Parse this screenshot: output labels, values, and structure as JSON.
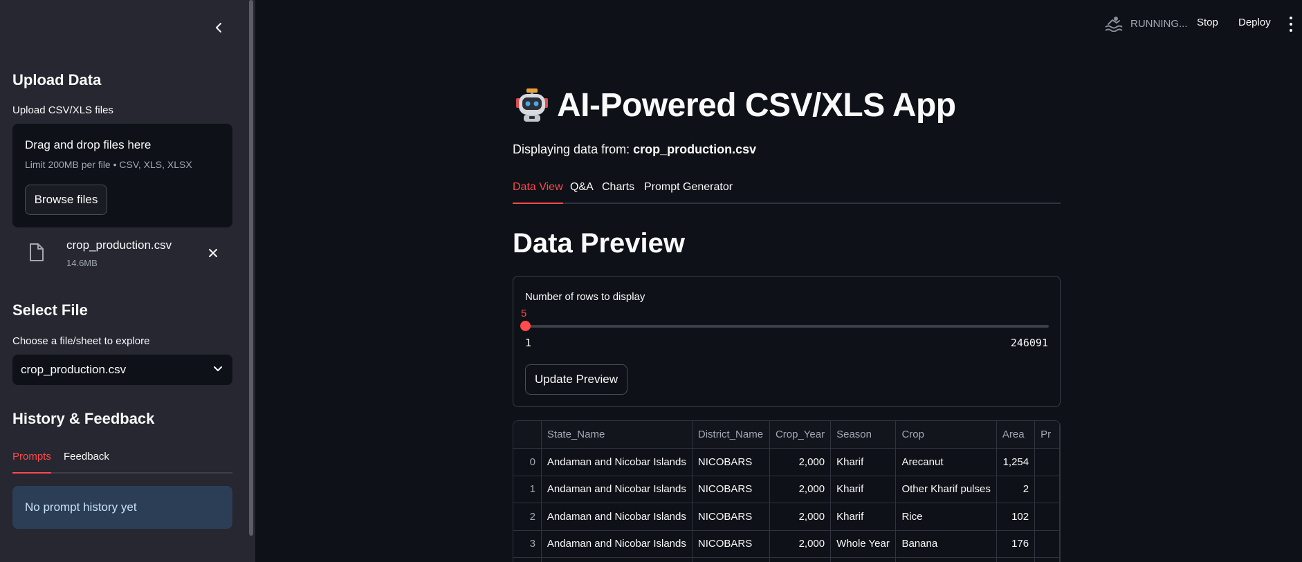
{
  "sidebar": {
    "upload_heading": "Upload Data",
    "upload_label": "Upload CSV/XLS files",
    "dropzone_title": "Drag and drop files here",
    "dropzone_limit": "Limit 200MB per file • CSV, XLS, XLSX",
    "browse_label": "Browse files",
    "uploaded_file": {
      "name": "crop_production.csv",
      "size": "14.6MB"
    },
    "select_heading": "Select File",
    "select_label": "Choose a file/sheet to explore",
    "select_value": "crop_production.csv",
    "history_heading": "History & Feedback",
    "tabs": [
      "Prompts",
      "Feedback"
    ],
    "active_tab": "Prompts",
    "info_message": "No prompt history yet"
  },
  "topbar": {
    "status": "RUNNING...",
    "stop_label": "Stop",
    "deploy_label": "Deploy"
  },
  "main": {
    "title": "AI-Powered CSV/XLS App",
    "subtitle_prefix": "Displaying data from: ",
    "subtitle_file": "crop_production.csv",
    "tabs": [
      "Data View",
      "Q&A",
      "Charts",
      "Prompt Generator"
    ],
    "active_tab": "Data View",
    "section_title": "Data Preview",
    "slider": {
      "label": "Number of rows to display",
      "value": "5",
      "min": "1",
      "max": "246091"
    },
    "update_button": "Update Preview",
    "table": {
      "columns": [
        "",
        "State_Name",
        "District_Name",
        "Crop_Year",
        "Season",
        "Crop",
        "Area",
        "Pr"
      ],
      "rows": [
        [
          "0",
          "Andaman and Nicobar Islands",
          "NICOBARS",
          "2,000",
          "Kharif",
          "Arecanut",
          "1,254",
          ""
        ],
        [
          "1",
          "Andaman and Nicobar Islands",
          "NICOBARS",
          "2,000",
          "Kharif",
          "Other Kharif pulses",
          "2",
          ""
        ],
        [
          "2",
          "Andaman and Nicobar Islands",
          "NICOBARS",
          "2,000",
          "Kharif",
          "Rice",
          "102",
          ""
        ],
        [
          "3",
          "Andaman and Nicobar Islands",
          "NICOBARS",
          "2,000",
          "Whole Year",
          "Banana",
          "176",
          ""
        ],
        [
          "",
          "",
          "",
          "",
          "",
          "",
          "",
          ""
        ]
      ]
    }
  },
  "colors": {
    "accent": "#ff4b4b",
    "background": "#0e1117",
    "sidebar": "#262730",
    "info_bg": "#2c3e55"
  }
}
